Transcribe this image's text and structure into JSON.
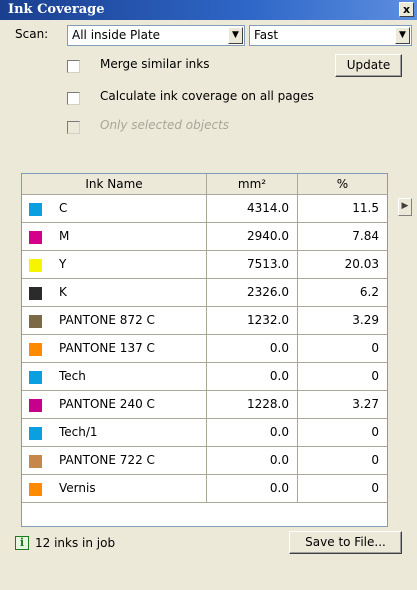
{
  "window": {
    "title": "Ink Coverage",
    "close_label": "x"
  },
  "scan": {
    "label": "Scan:",
    "area_value": "All inside Plate",
    "speed_value": "Fast"
  },
  "options": {
    "merge_label": "Merge similar inks",
    "all_pages_label": "Calculate ink coverage on all pages",
    "selected_only_label": "Only selected objects"
  },
  "update_label": "Update",
  "table": {
    "headers": [
      "Ink Name",
      "mm²",
      "%"
    ],
    "rows": [
      {
        "color": "#0a9fe0",
        "name": "C",
        "area": "4314.0",
        "pct": "11.5"
      },
      {
        "color": "#d4008b",
        "name": "M",
        "area": "2940.0",
        "pct": "7.84"
      },
      {
        "color": "#f8f400",
        "name": "Y",
        "area": "7513.0",
        "pct": "20.03"
      },
      {
        "color": "#2b2b2b",
        "name": "K",
        "area": "2326.0",
        "pct": "6.2"
      },
      {
        "color": "#7c6a44",
        "name": "PANTONE 872 C",
        "area": "1232.0",
        "pct": "3.29"
      },
      {
        "color": "#ff8a00",
        "name": "PANTONE 137 C",
        "area": "0.0",
        "pct": "0"
      },
      {
        "color": "#0a9fe0",
        "name": "Tech",
        "area": "0.0",
        "pct": "0"
      },
      {
        "color": "#c6008d",
        "name": "PANTONE 240 C",
        "area": "1228.0",
        "pct": "3.27"
      },
      {
        "color": "#0a9fe0",
        "name": "Tech/1",
        "area": "0.0",
        "pct": "0"
      },
      {
        "color": "#c8874a",
        "name": "PANTONE 722 C",
        "area": "0.0",
        "pct": "0"
      },
      {
        "color": "#ff8a00",
        "name": "Vernis",
        "area": "0.0",
        "pct": "0"
      }
    ]
  },
  "status": {
    "icon": "info-icon",
    "text": "12 inks in job"
  },
  "save_label": "Save to File..."
}
